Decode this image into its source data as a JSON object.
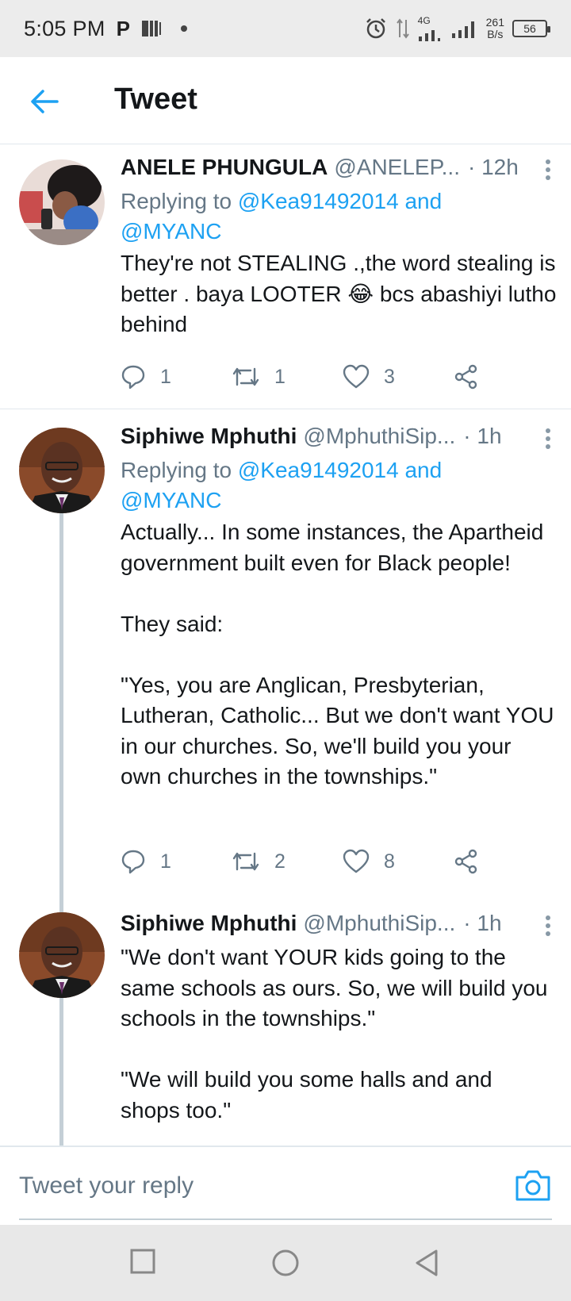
{
  "status_bar": {
    "time": "5:05 PM",
    "network": "4G",
    "speed_value": "261",
    "speed_unit": "B/s",
    "battery": "56"
  },
  "header": {
    "title": "Tweet"
  },
  "tweets": [
    {
      "name": "ANELE PHUNGULA",
      "handle": "@ANELEP...",
      "time": "· 12h",
      "replying_prefix": "Replying to",
      "replying_to_1": "@Kea91492014",
      "replying_and": "and",
      "replying_to_2": "@MYANC",
      "text": "They're not STEALING .,the word stealing is better   . baya LOOTER 😂 bcs abashiyi lutho behind",
      "replies": "1",
      "retweets": "1",
      "likes": "3"
    },
    {
      "name": "Siphiwe Mphuthi",
      "handle": "@MphuthiSip...",
      "time": "· 1h",
      "replying_prefix": "Replying to",
      "replying_to_1": "@Kea91492014",
      "replying_and": "and",
      "replying_to_2": "@MYANC",
      "text": "Actually... In some instances, the Apartheid government built even for Black people!\n\nThey said:\n\n\"Yes, you are Anglican, Presbyterian, Lutheran, Catholic... But we don't want YOU in our churches. So, we'll build you your own churches in the townships.\"",
      "replies": "1",
      "retweets": "2",
      "likes": "8"
    },
    {
      "name": "Siphiwe Mphuthi",
      "handle": "@MphuthiSip...",
      "time": "· 1h",
      "text": "\"We don't want YOUR kids going to the same schools as ours. So, we will build you schools in the townships.\"\n\n\"We will build you some halls and and shops too.\""
    }
  ],
  "reply_bar": {
    "placeholder": "Tweet your reply"
  },
  "colors": {
    "accent": "#1da1f2",
    "secondary_text": "#657786",
    "primary_text": "#14171a"
  }
}
